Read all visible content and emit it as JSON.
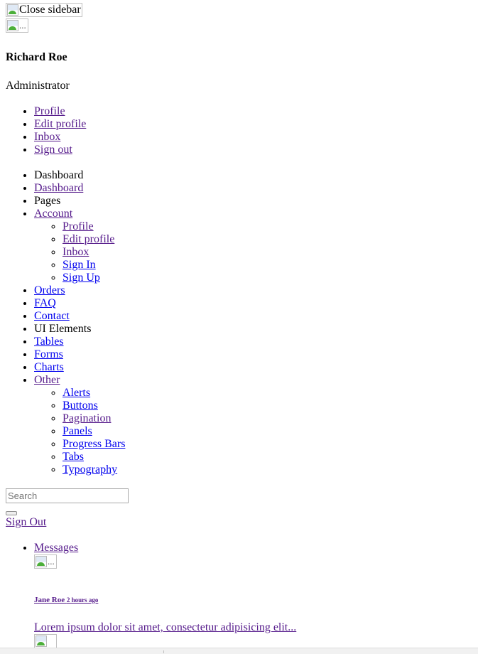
{
  "header": {
    "close_sidebar_alt": "Close sidebar",
    "avatar_alt": "...",
    "user_name": "Richard Roe",
    "user_role": "Administrator"
  },
  "user_menu": [
    {
      "label": " Profile",
      "visited": true
    },
    {
      "label": " Edit profile",
      "visited": true
    },
    {
      "label": " Inbox",
      "visited": true
    },
    {
      "label": " Sign out",
      "visited": true
    }
  ],
  "nav": {
    "section_dashboard": "Dashboard",
    "dashboard": " Dashboard",
    "section_pages": "Pages",
    "account": " Account",
    "account_items": [
      "Profile",
      "Edit profile",
      "Inbox",
      "Sign In",
      "Sign Up"
    ],
    "orders": " Orders",
    "faq": " FAQ",
    "contact": " Contact",
    "section_ui": "UI Elements",
    "tables": " Tables",
    "forms": " Forms",
    "charts": " Charts",
    "other": " Other",
    "other_items": [
      "Alerts",
      "Buttons",
      "Pagination",
      "Panels",
      "Progress Bars",
      "Tabs",
      "Typography"
    ]
  },
  "search": {
    "placeholder": "Search",
    "value": ""
  },
  "sign_out": "Sign Out",
  "messages": {
    "label": "Messages",
    "items": [
      {
        "avatar_alt": "...",
        "sender": "Jane Roe",
        "time": "2 hours ago",
        "text": "Lorem ipsum dolor sit amet, consectetur adipisicing elit..."
      },
      {
        "avatar_alt": ""
      }
    ]
  },
  "colors": {
    "link": "#0000EE",
    "visited_link": "#551A8B"
  }
}
